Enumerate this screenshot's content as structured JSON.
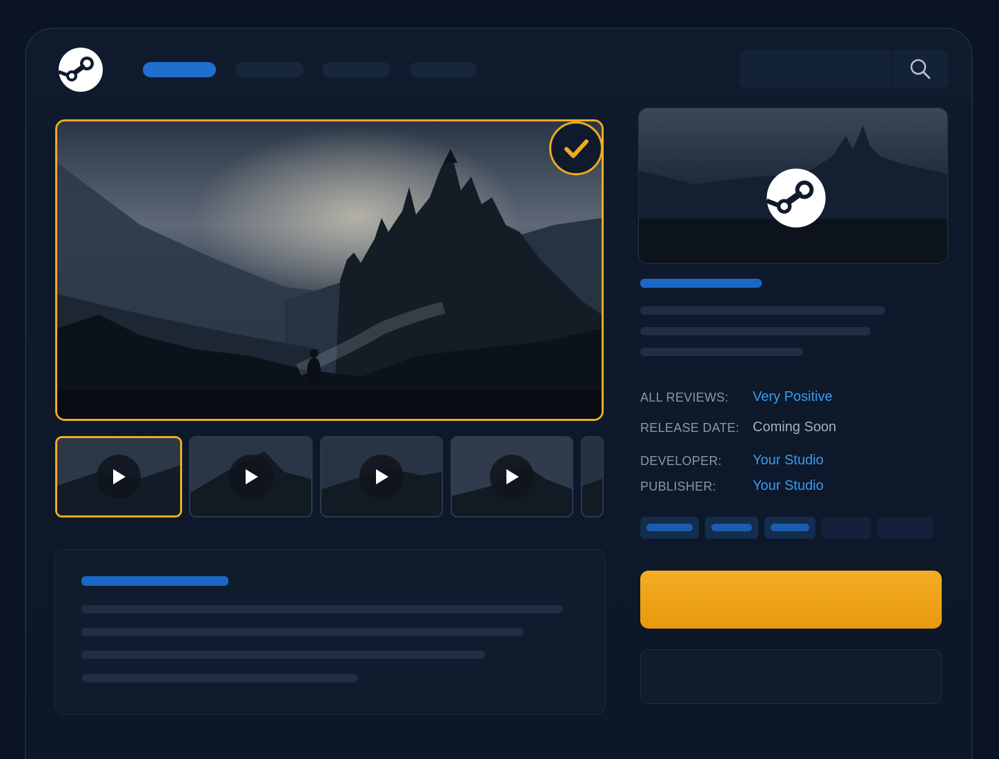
{
  "app": {
    "name": "Steam store page"
  },
  "header": {
    "logo_icon": "steam-logo-icon",
    "nav_items": [
      {
        "active": true
      },
      {
        "active": false
      },
      {
        "active": false
      },
      {
        "active": false
      }
    ],
    "search": {
      "placeholder": "",
      "icon": "search-icon"
    }
  },
  "media": {
    "selected_index": 0,
    "selected_badge_icon": "checkmark-icon",
    "thumbnails": [
      {
        "type": "video",
        "icon": "play-icon"
      },
      {
        "type": "video",
        "icon": "play-icon"
      },
      {
        "type": "video",
        "icon": "play-icon"
      },
      {
        "type": "video",
        "icon": "play-icon"
      },
      {
        "type": "image"
      }
    ]
  },
  "info": {
    "all_reviews_label": "ALL REVIEWS:",
    "all_reviews_value": "Very Positive",
    "release_date_label": "RELEASE DATE:",
    "release_date_value": "Coming Soon",
    "developer_label": "DEVELOPER:",
    "developer_value": "Your Studio",
    "publisher_label": "PUBLISHER:",
    "publisher_value": "Your Studio"
  },
  "colors": {
    "background": "#0a1423",
    "accent_blue": "#1f6fd1",
    "link_blue": "#3a9bf0",
    "highlight_orange": "#f0ac1e",
    "buy_button": "#f4ae23"
  }
}
